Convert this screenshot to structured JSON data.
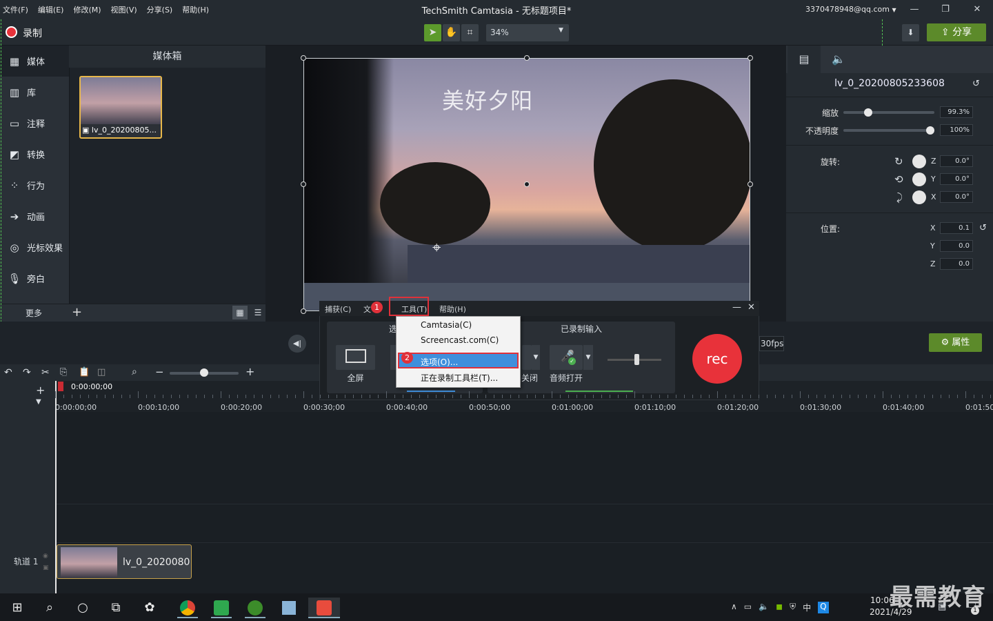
{
  "window": {
    "title": "TechSmith Camtasia - 无标题项目*",
    "account": "3370478948@qq.com",
    "menus": [
      "文件(F)",
      "编辑(E)",
      "修改(M)",
      "视图(V)",
      "分享(S)",
      "帮助(H)"
    ]
  },
  "toolbar": {
    "record_label": "录制",
    "zoom": "34%",
    "share_label": "分享"
  },
  "sidebar": {
    "items": [
      {
        "label": "媒体",
        "icon": "film-icon"
      },
      {
        "label": "库",
        "icon": "library-icon"
      },
      {
        "label": "注释",
        "icon": "annotation-icon"
      },
      {
        "label": "转换",
        "icon": "transition-icon"
      },
      {
        "label": "行为",
        "icon": "behavior-icon"
      },
      {
        "label": "动画",
        "icon": "animation-icon"
      },
      {
        "label": "光标效果",
        "icon": "cursor-effect-icon"
      },
      {
        "label": "旁白",
        "icon": "microphone-icon"
      }
    ],
    "more_label": "更多"
  },
  "media_bin": {
    "title": "媒体箱",
    "items": [
      {
        "label": "lv_0_20200805..."
      }
    ]
  },
  "canvas": {
    "video_caption": "美好夕阳"
  },
  "properties": {
    "clip_name": "lv_0_20200805233608",
    "scale_label": "缩放",
    "scale_value": "99.3%",
    "scale_level": 0.993,
    "opacity_label": "不透明度",
    "opacity_value": "100%",
    "opacity_level": 1.0,
    "rotation_label": "旋转:",
    "rotation": [
      {
        "axis": "Z",
        "value": "0.0°"
      },
      {
        "axis": "Y",
        "value": "0.0°"
      },
      {
        "axis": "X",
        "value": "0.0°"
      }
    ],
    "position_label": "位置:",
    "position": [
      {
        "axis": "X",
        "value": "0.1"
      },
      {
        "axis": "Y",
        "value": "0.0"
      },
      {
        "axis": "Z",
        "value": "0.0"
      }
    ],
    "properties_button": "属性"
  },
  "recorder": {
    "menus": [
      "捕获(C)",
      "文",
      "工具(T)",
      "帮助(H)"
    ],
    "section_select": "选",
    "fullscreen_label": "全屏",
    "recorded_input_label": "已录制输入",
    "camera_off_label": "关闭",
    "audio_on_label": "音频打开",
    "rec_label": "rec",
    "fps": "30fps",
    "dropdown": [
      "Camtasia(C)",
      "Screencast.com(C)",
      "选项(O)...",
      "正在录制工具栏(T)..."
    ],
    "badges": [
      "1",
      "2"
    ]
  },
  "timeline": {
    "current_time": "0:00:00;00",
    "ticks": [
      "0:00:00;00",
      "0:00:10;00",
      "0:00:20;00",
      "0:00:30;00",
      "0:00:40;00",
      "0:00:50;00",
      "0:01:00;00",
      "0:01:10;00",
      "0:01:20;00",
      "0:01:30;00",
      "0:01:40;00",
      "0:01:50;"
    ],
    "track_label": "轨道 1",
    "clip_label": "lv_0_2020080"
  },
  "taskbar": {
    "time": "10:06",
    "date": "2021/4/29",
    "ime": "中",
    "notification_count": "1"
  },
  "watermark": "最需教育"
}
